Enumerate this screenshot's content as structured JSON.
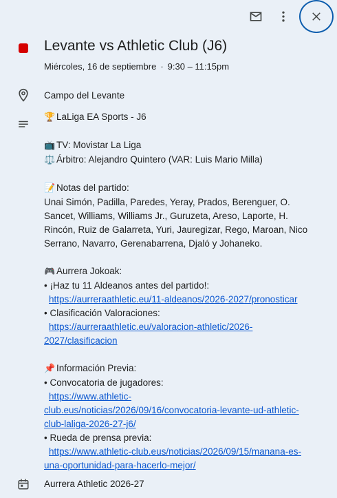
{
  "event": {
    "title": "Levante vs Athletic Club (J6)",
    "date": "Miércoles, 16 de septiembre",
    "date_sep": "·",
    "time": "9:30 – 11:15pm",
    "color": "#d50000"
  },
  "location": "Campo del Levante",
  "description": {
    "competition": "LaLiga EA Sports - J6",
    "tv": "TV: Movistar La Liga",
    "referee": "Árbitro: Alejandro Quintero (VAR: Luis Mario Milla)",
    "notes_heading": "Notas del partido:",
    "notes_lines": [
      "Unai Simón, Padilla, Paredes, Yeray, Prados, Berenguer, O.",
      "Sancet, Williams, Williams Jr., Guruzeta, Areso, Laporte, H.",
      "Rincón, Ruiz de Galarreta, Yuri, Jauregizar, Rego, Maroan, Nico",
      "Serrano, Navarro, Gerenabarrena, Djaló y Johaneko."
    ],
    "jokoak_heading": "Aurrera Jokoak:",
    "bullet1": "• ¡Haz tu 11 Aldeanos antes del partido!:",
    "link1": "https://aurreraathletic.eu/11-aldeanos/2026-2027/pronosticar",
    "bullet2": "• Clasificación Valoraciones:",
    "link2_a": "https://aurreraathletic.eu/valoracion-athletic/2026-",
    "link2_b": "2027/clasificacion",
    "previa_heading": "Información Previa:",
    "bullet3": "• Convocatoria de jugadores:",
    "link3_a": "https://www.athletic-",
    "link3_b": "club.eus/noticias/2026/09/16/convocatoria-levante-ud-athletic-",
    "link3_c": "club-laliga-2026-27-j6/",
    "bullet4": "• Rueda de prensa previa:",
    "link4_a": "https://www.athletic-club.eus/noticias/2026/09/15/manana-es-",
    "link4_b": "una-oportunidad-para-hacerlo-mejor/"
  },
  "calendar": "Aurrera Athletic 2026-27",
  "icons": {
    "trophy": "🏆",
    "tv": "📺",
    "scales": "⚖️",
    "memo": "📝",
    "gamepad": "🎮",
    "pin": "📌"
  }
}
